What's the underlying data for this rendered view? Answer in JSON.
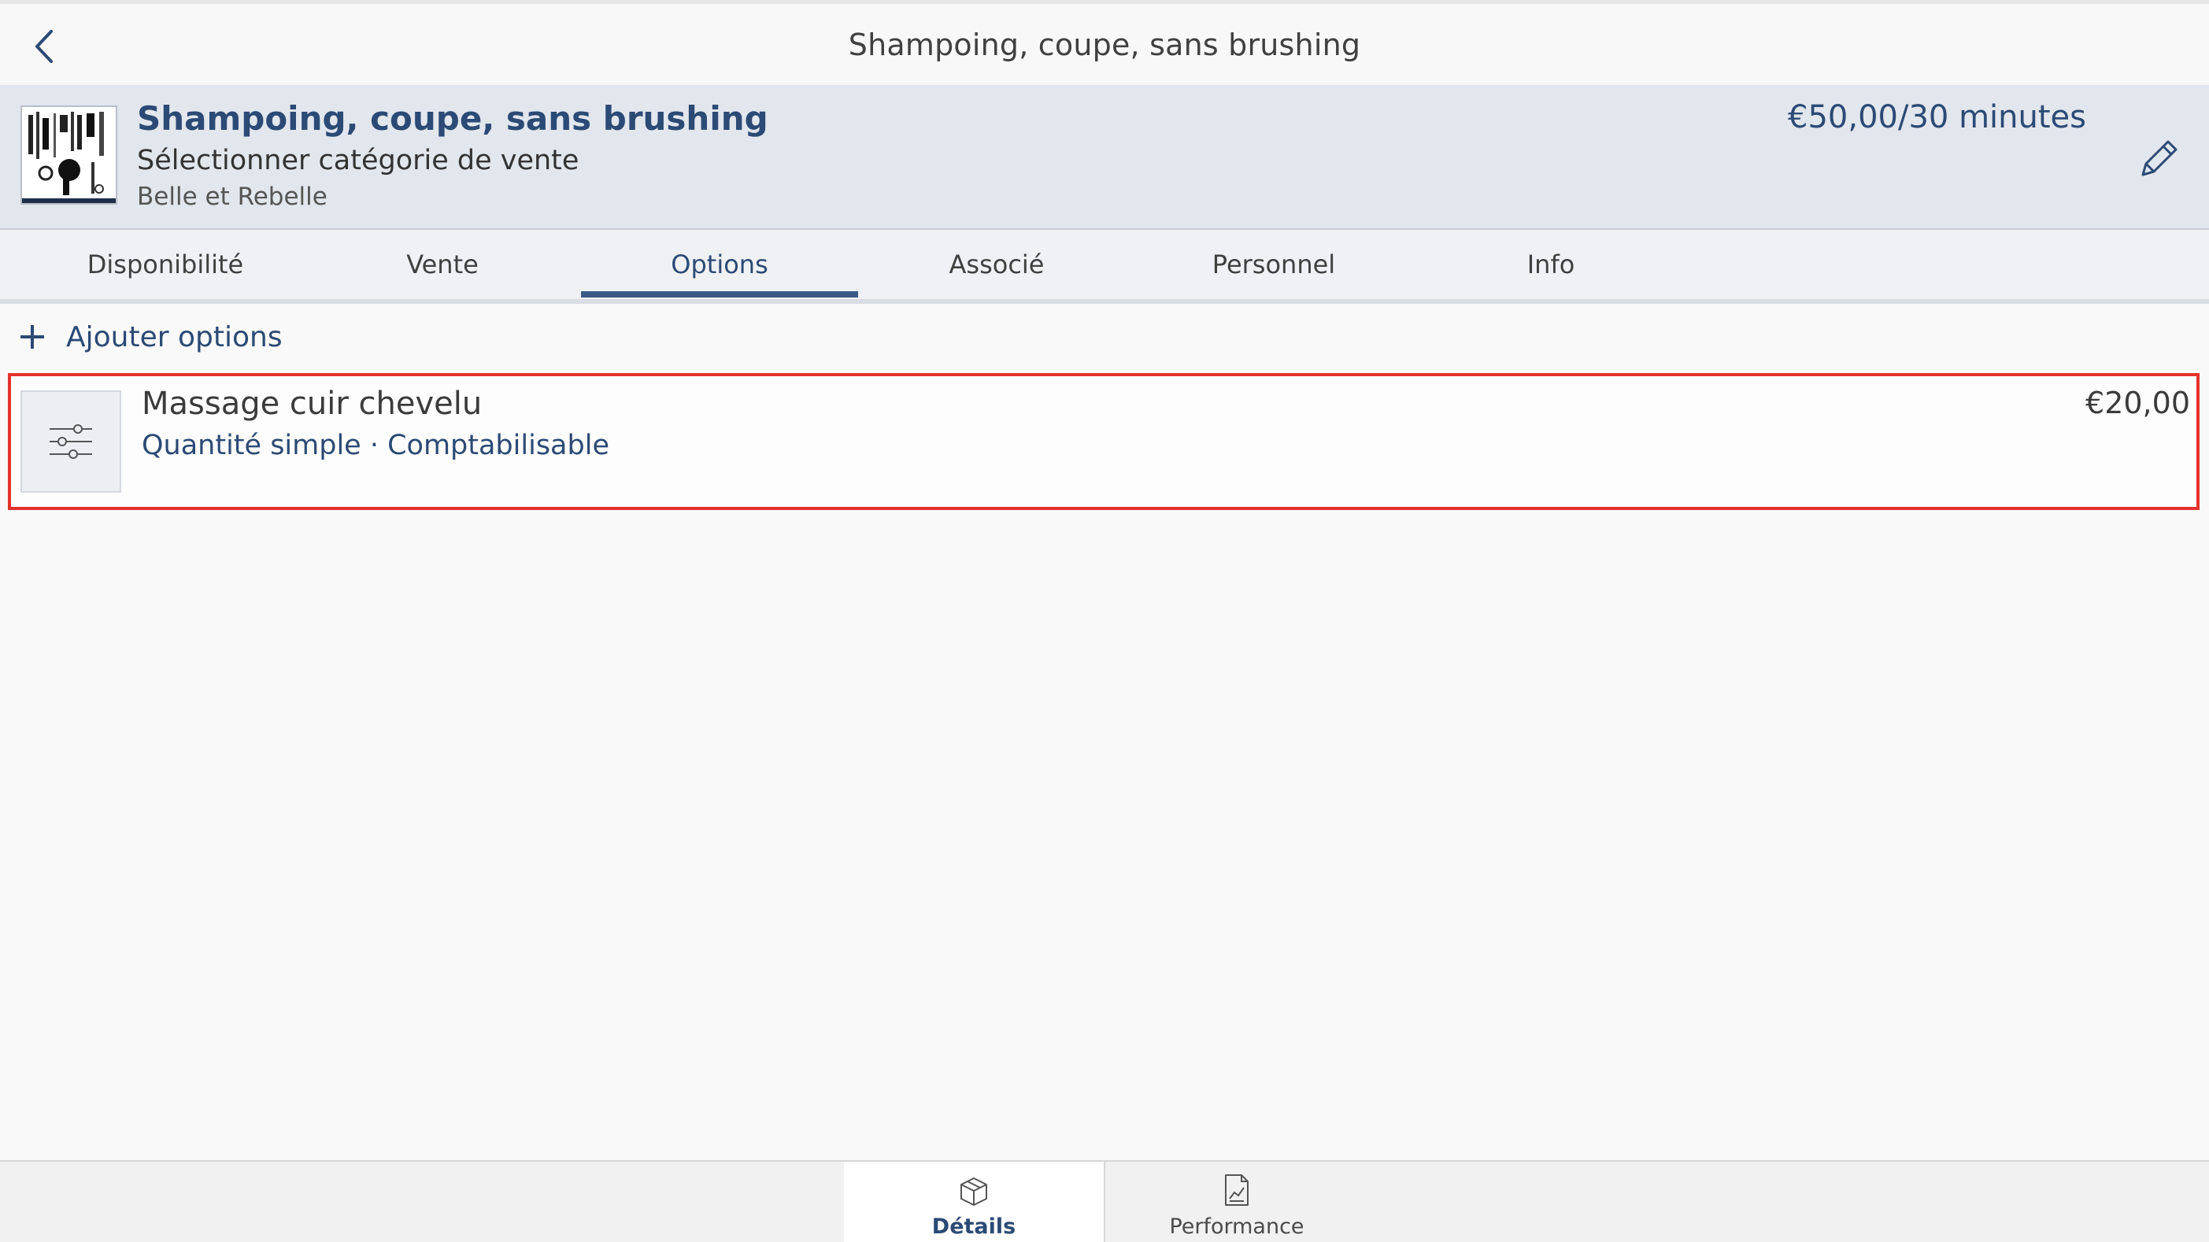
{
  "nav": {
    "title": "Shampoing, coupe, sans brushing",
    "back_icon": "chevron-left-icon"
  },
  "service": {
    "name": "Shampoing, coupe, sans brushing",
    "sale_category": "Sélectionner catégorie de vente",
    "salon": "Belle et Rebelle",
    "price_duration": "€50,00/30 minutes",
    "edit_icon": "pencil-icon"
  },
  "tabs": [
    {
      "label": "Disponibilité",
      "active": false
    },
    {
      "label": "Vente",
      "active": false
    },
    {
      "label": "Options",
      "active": true
    },
    {
      "label": "Associé",
      "active": false
    },
    {
      "label": "Personnel",
      "active": false
    },
    {
      "label": "Info",
      "active": false
    }
  ],
  "options": {
    "add_label": "Ajouter options",
    "items": [
      {
        "name": "Massage cuir chevelu",
        "meta": "Quantité simple · Comptabilisable",
        "price": "€20,00",
        "icon": "sliders-icon"
      }
    ]
  },
  "bottom_tabs": [
    {
      "label": "Détails",
      "icon": "box-icon",
      "active": true
    },
    {
      "label": "Performance",
      "icon": "chart-document-icon",
      "active": false
    }
  ],
  "colors": {
    "accent": "#2b4a75",
    "highlight_border": "#e3322b",
    "header_bg": "#e2e6ed"
  }
}
